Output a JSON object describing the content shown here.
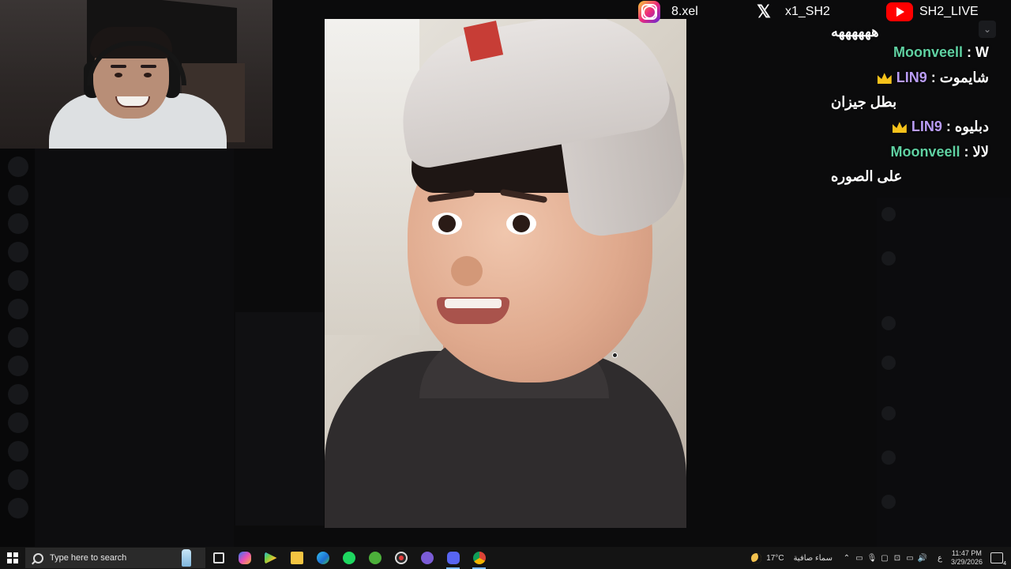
{
  "socials": {
    "instagram": "8.xel",
    "x": "x1_SH2",
    "youtube": "SH2_LIVE"
  },
  "chat": {
    "top_partial": "ههههههه",
    "messages": [
      {
        "user": "Moonveell",
        "text": "W",
        "crown": false,
        "color": "#5fd1a2"
      },
      {
        "user": "LIN9",
        "text": "شايموت",
        "crown": true,
        "color": "#b99cf5"
      },
      {
        "continuation": "بطل جيزان"
      },
      {
        "user": "LIN9",
        "text": "دبليوه",
        "crown": true,
        "color": "#b99cf5"
      },
      {
        "user": "Moonveell",
        "text": "لالا",
        "crown": false,
        "color": "#5fd1a2"
      },
      {
        "continuation": "على الصوره"
      }
    ]
  },
  "taskbar": {
    "search_placeholder": "Type here to search",
    "icons": [
      "task-view-icon",
      "copilot-icon",
      "play-store-icon",
      "file-explorer-icon",
      "edge-icon",
      "spotify-icon",
      "xbox-icon",
      "recorder-icon",
      "app-icon",
      "discord-icon",
      "chrome-icon"
    ],
    "weather_temp": "17°C",
    "weather_text": "سماء صافية",
    "ime": "ع",
    "time": "11:47 PM",
    "date": "3/29/2026",
    "notification_count": "4"
  },
  "colors": {
    "taskbar": "#141414",
    "chat_green": "#5fd1a2",
    "chat_purple": "#b99cf5",
    "crown": "#f6c21b"
  }
}
